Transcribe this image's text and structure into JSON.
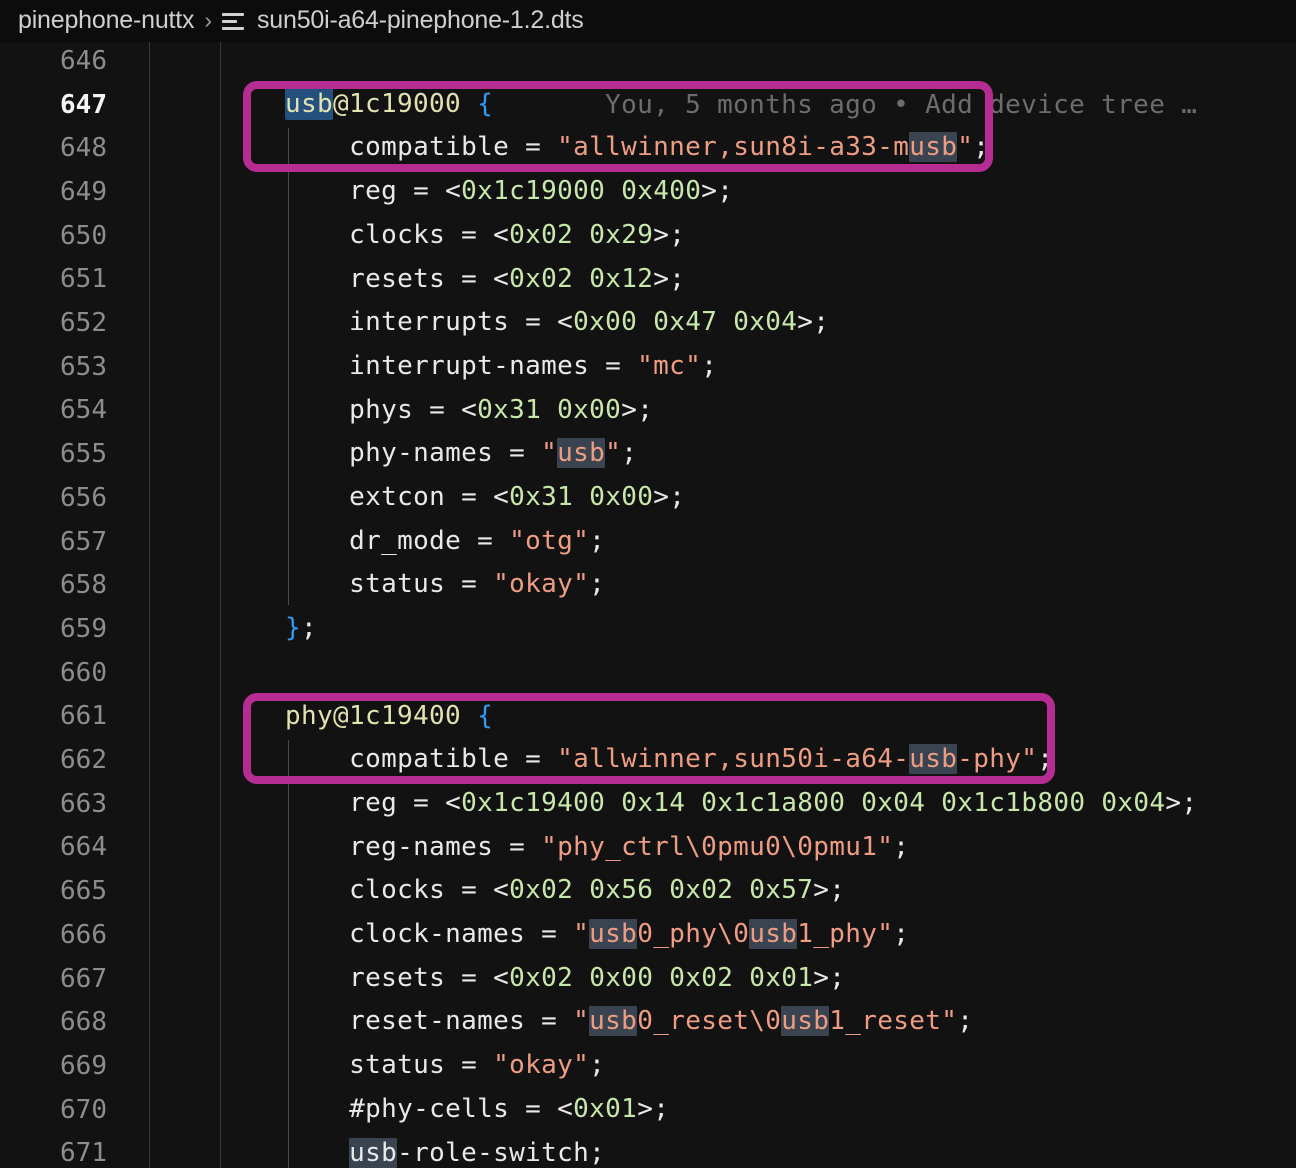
{
  "breadcrumb": {
    "repo": "pinephone-nuttx",
    "separator": "›",
    "file_icon": "file-lines-icon",
    "file": "sun50i-a64-pinephone-1.2.dts"
  },
  "editor": {
    "theme_background": "#121212",
    "selection_color": "#24507f",
    "match_highlight_color": "#3a4450",
    "annotation_color": "#b52c93",
    "active_line": 647,
    "first_line": 646,
    "last_line": 671,
    "search_term": "usb",
    "blame": {
      "line": 647,
      "text": "You, 5 months ago • Add device tree …"
    },
    "lines": [
      {
        "n": 646,
        "text": ""
      },
      {
        "n": 647,
        "text": "usb@1c19000 {"
      },
      {
        "n": 648,
        "text": "    compatible = \"allwinner,sun8i-a33-musb\";"
      },
      {
        "n": 649,
        "text": "    reg = <0x1c19000 0x400>;"
      },
      {
        "n": 650,
        "text": "    clocks = <0x02 0x29>;"
      },
      {
        "n": 651,
        "text": "    resets = <0x02 0x12>;"
      },
      {
        "n": 652,
        "text": "    interrupts = <0x00 0x47 0x04>;"
      },
      {
        "n": 653,
        "text": "    interrupt-names = \"mc\";"
      },
      {
        "n": 654,
        "text": "    phys = <0x31 0x00>;"
      },
      {
        "n": 655,
        "text": "    phy-names = \"usb\";"
      },
      {
        "n": 656,
        "text": "    extcon = <0x31 0x00>;"
      },
      {
        "n": 657,
        "text": "    dr_mode = \"otg\";"
      },
      {
        "n": 658,
        "text": "    status = \"okay\";"
      },
      {
        "n": 659,
        "text": "};"
      },
      {
        "n": 660,
        "text": ""
      },
      {
        "n": 661,
        "text": "phy@1c19400 {"
      },
      {
        "n": 662,
        "text": "    compatible = \"allwinner,sun50i-a64-usb-phy\";"
      },
      {
        "n": 663,
        "text": "    reg = <0x1c19400 0x14 0x1c1a800 0x04 0x1c1b800 0x04>;"
      },
      {
        "n": 664,
        "text": "    reg-names = \"phy_ctrl\\0pmu0\\0pmu1\";"
      },
      {
        "n": 665,
        "text": "    clocks = <0x02 0x56 0x02 0x57>;"
      },
      {
        "n": 666,
        "text": "    clock-names = \"usb0_phy\\0usb1_phy\";"
      },
      {
        "n": 667,
        "text": "    resets = <0x02 0x00 0x02 0x01>;"
      },
      {
        "n": 668,
        "text": "    reset-names = \"usb0_reset\\0usb1_reset\";"
      },
      {
        "n": 669,
        "text": "    status = \"okay\";"
      },
      {
        "n": 670,
        "text": "    #phy-cells = <0x01>;"
      },
      {
        "n": 671,
        "text": "    usb-role-switch;"
      }
    ],
    "annotations": [
      {
        "label": "usb-node-highlight",
        "lines": [
          647,
          648
        ]
      },
      {
        "label": "phy-node-highlight",
        "lines": [
          661,
          662
        ]
      }
    ]
  }
}
